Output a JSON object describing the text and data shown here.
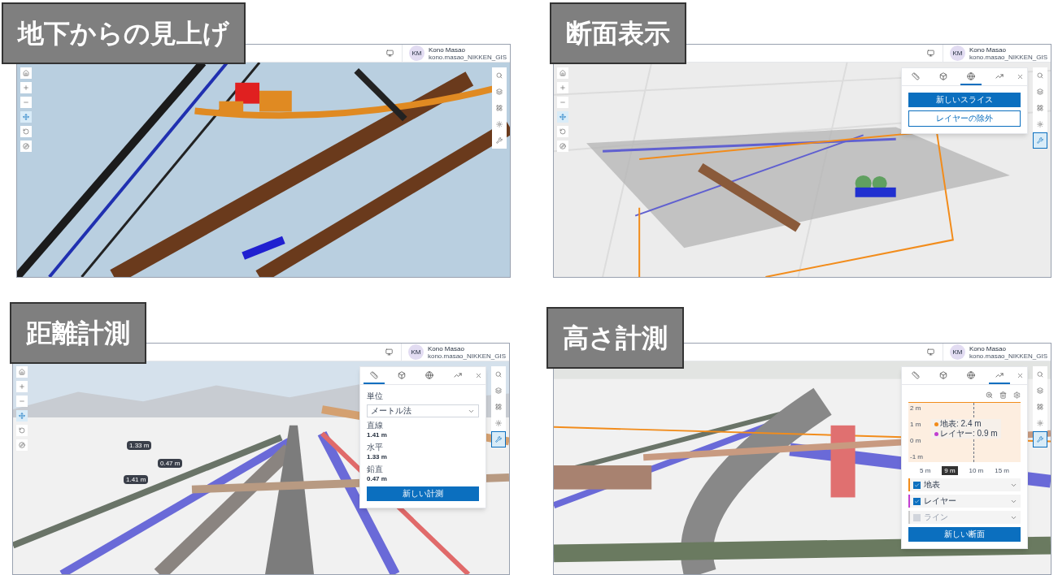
{
  "quadrants": [
    {
      "title": "地下からの見上げ",
      "user": {
        "initials": "KM",
        "name": "Kono Masao",
        "id": "kono.masao_NIKKEN_GIS"
      },
      "left_tools": [
        {
          "kind": "home",
          "selected": false
        },
        {
          "kind": "zoom-in",
          "selected": false
        },
        {
          "kind": "zoom-out",
          "selected": false
        },
        {
          "kind": "pan",
          "selected": true
        },
        {
          "kind": "rotate",
          "selected": false
        },
        {
          "kind": "compass",
          "selected": false
        }
      ],
      "right_tools": [
        {
          "kind": "search",
          "selected": false
        },
        {
          "kind": "layers",
          "selected": false
        },
        {
          "kind": "grid",
          "selected": false
        },
        {
          "kind": "daylight",
          "selected": false
        },
        {
          "kind": "analysis",
          "selected": false
        }
      ]
    },
    {
      "title": "断面表示",
      "user": {
        "initials": "KM",
        "name": "Kono Masao",
        "id": "kono.masao_NIKKEN_GIS"
      },
      "left_tools": [
        {
          "kind": "home",
          "selected": false
        },
        {
          "kind": "zoom-in",
          "selected": false
        },
        {
          "kind": "zoom-out",
          "selected": false
        },
        {
          "kind": "pan",
          "selected": true
        },
        {
          "kind": "rotate",
          "selected": false
        },
        {
          "kind": "compass",
          "selected": false
        }
      ],
      "right_tools": [
        {
          "kind": "search",
          "selected": false
        },
        {
          "kind": "layers",
          "selected": false
        },
        {
          "kind": "grid",
          "selected": false
        },
        {
          "kind": "daylight",
          "selected": false
        },
        {
          "kind": "analysis",
          "selected": true
        }
      ],
      "tool_panel": {
        "kind": "slice",
        "tabs": [
          {
            "kind": "distance",
            "selected": false
          },
          {
            "kind": "area",
            "selected": false
          },
          {
            "kind": "slice",
            "selected": true
          },
          {
            "kind": "elevation",
            "selected": false
          }
        ],
        "primary_button": "新しいスライス",
        "secondary_button": "レイヤーの除外"
      }
    },
    {
      "title": "距離計測",
      "user": {
        "initials": "KM",
        "name": "Kono Masao",
        "id": "kono.masao_NIKKEN_GIS"
      },
      "scene_labels": [
        "1.33 m",
        "0.47 m",
        "1.41 m"
      ],
      "left_tools": [
        {
          "kind": "home",
          "selected": false
        },
        {
          "kind": "zoom-in",
          "selected": false
        },
        {
          "kind": "zoom-out",
          "selected": false
        },
        {
          "kind": "pan",
          "selected": true
        },
        {
          "kind": "rotate",
          "selected": false
        },
        {
          "kind": "compass",
          "selected": false
        }
      ],
      "right_tools": [
        {
          "kind": "search",
          "selected": false
        },
        {
          "kind": "layers",
          "selected": false
        },
        {
          "kind": "grid",
          "selected": false
        },
        {
          "kind": "daylight",
          "selected": false
        },
        {
          "kind": "analysis",
          "selected": true
        }
      ],
      "tool_panel": {
        "kind": "measure",
        "tabs": [
          {
            "kind": "distance",
            "selected": true
          },
          {
            "kind": "area",
            "selected": false
          },
          {
            "kind": "slice",
            "selected": false
          },
          {
            "kind": "elevation",
            "selected": false
          }
        ],
        "unit_label": "単位",
        "unit_value": "メートル法",
        "readings": [
          {
            "label": "直線",
            "value": "1.41 m"
          },
          {
            "label": "水平",
            "value": "1.33 m"
          },
          {
            "label": "鉛直",
            "value": "0.47 m"
          }
        ],
        "primary_button": "新しい計測"
      }
    },
    {
      "title": "高さ計測",
      "user": {
        "initials": "KM",
        "name": "Kono Masao",
        "id": "kono.masao_NIKKEN_GIS"
      },
      "right_tools": [
        {
          "kind": "search",
          "selected": false
        },
        {
          "kind": "layers",
          "selected": false
        },
        {
          "kind": "grid",
          "selected": false
        },
        {
          "kind": "daylight",
          "selected": false
        },
        {
          "kind": "analysis",
          "selected": true
        }
      ],
      "tool_panel": {
        "kind": "profile",
        "tabs": [
          {
            "kind": "distance",
            "selected": false
          },
          {
            "kind": "area",
            "selected": false
          },
          {
            "kind": "slice",
            "selected": false
          },
          {
            "kind": "elevation",
            "selected": true
          }
        ],
        "profile": {
          "y_ticks": [
            "2 m",
            "1 m",
            "0 m",
            "-1 m"
          ],
          "x_ticks": [
            "5 m",
            "10 m",
            "15 m"
          ],
          "cursor": "9 m",
          "tooltip": [
            {
              "text": "地表: 2.4 m",
              "color": "#f28c1b"
            },
            {
              "text": "レイヤー: 0.9 m",
              "color": "#c13fd1"
            }
          ]
        },
        "lines": [
          {
            "label": "地表",
            "checked": true,
            "disabled": false,
            "color": "#f28c1b"
          },
          {
            "label": "レイヤー",
            "checked": true,
            "disabled": false,
            "color": "#c13fd1"
          },
          {
            "label": "ライン",
            "checked": false,
            "disabled": true,
            "color": "#cccccc"
          }
        ],
        "primary_button": "新しい断面"
      }
    }
  ]
}
